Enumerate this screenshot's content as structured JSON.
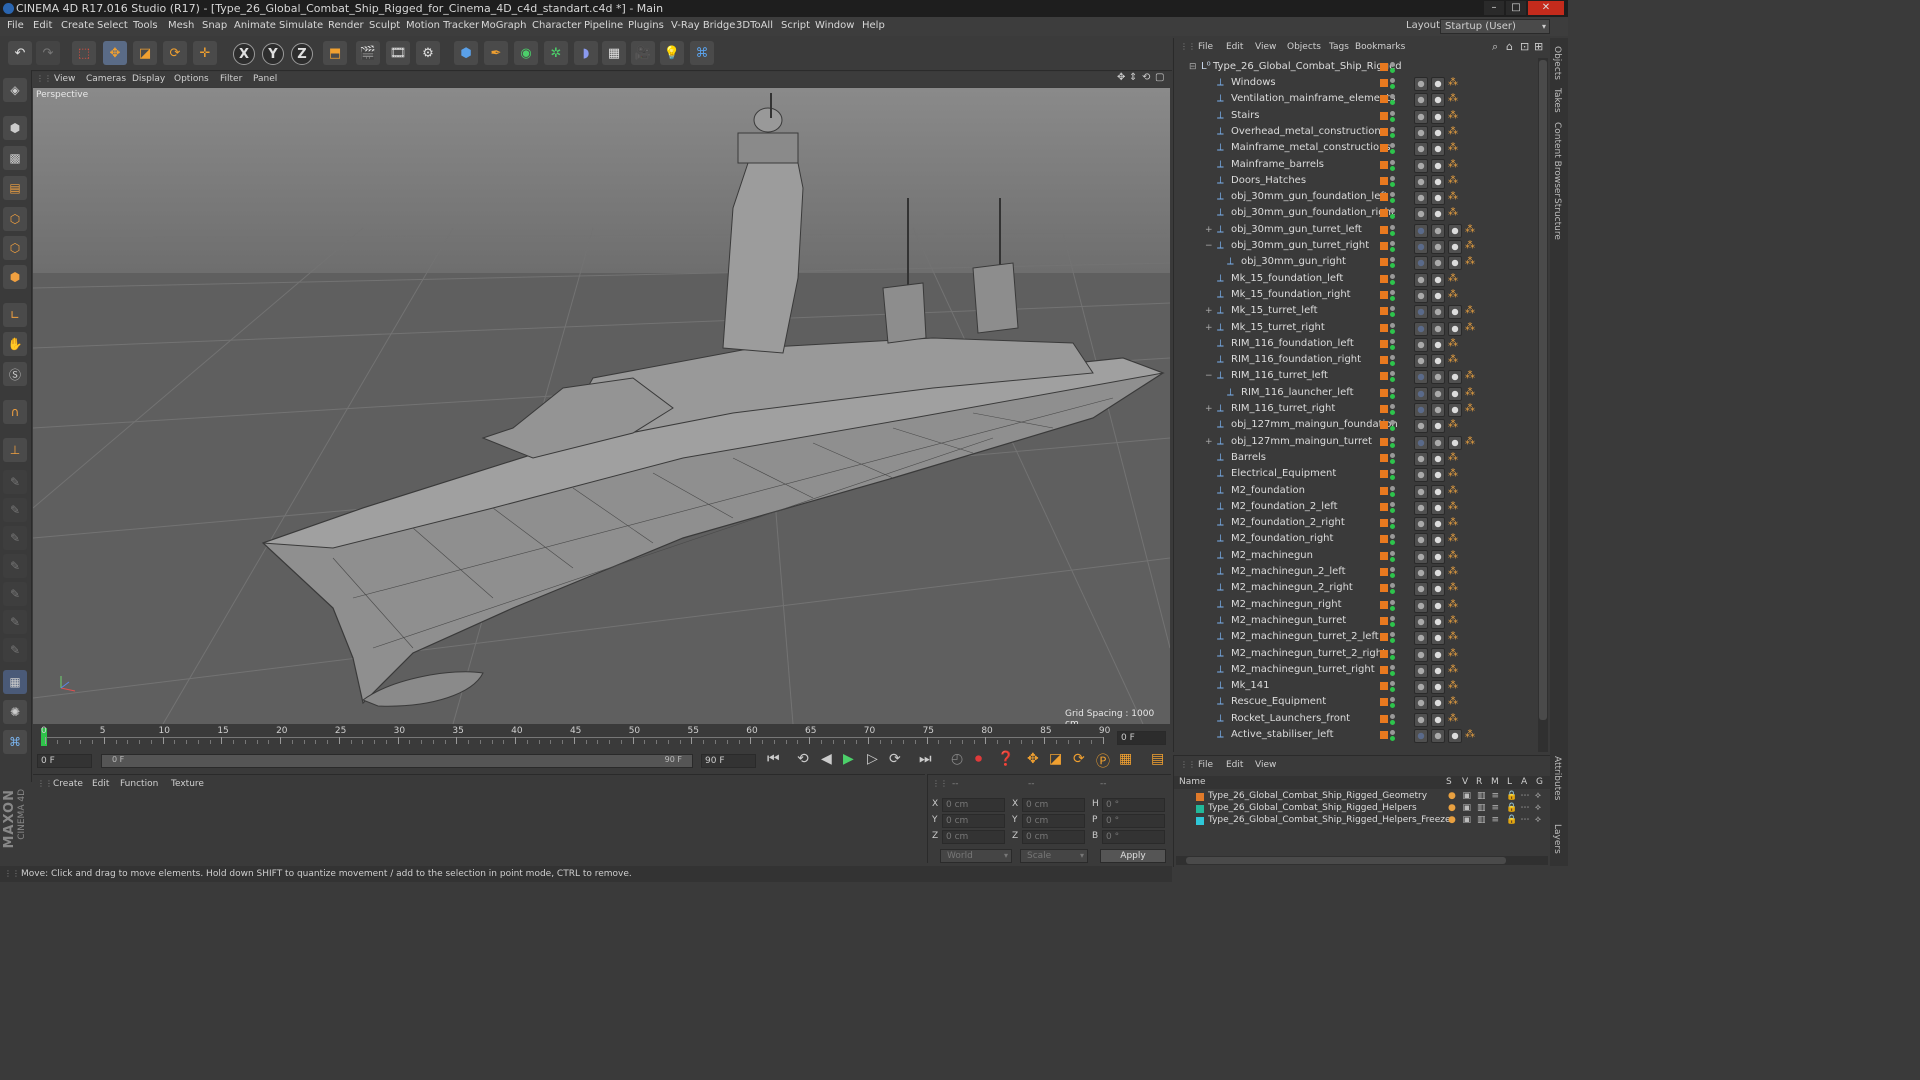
{
  "window": {
    "title": "CINEMA 4D R17.016 Studio (R17) - [Type_26_Global_Combat_Ship_Rigged_for_Cinema_4D_c4d_standart.c4d *] - Main",
    "min": "–",
    "max": "□",
    "close": "✕"
  },
  "menu": [
    "File",
    "Edit",
    "Create",
    "Select",
    "Tools",
    "Mesh",
    "Snap",
    "Animate",
    "Simulate",
    "Render",
    "Sculpt",
    "Motion Tracker",
    "MoGraph",
    "Character",
    "Pipeline",
    "Plugins",
    "V-Ray Bridge",
    "3DToAll",
    "Script",
    "Window",
    "Help"
  ],
  "layout": {
    "label": "Layout:",
    "value": "Startup (User)"
  },
  "toolbar": {
    "x": "X",
    "y": "Y",
    "z": "Z"
  },
  "viewport": {
    "menu": [
      "View",
      "Cameras",
      "Display",
      "Options",
      "Filter",
      "Panel"
    ],
    "name": "Perspective",
    "grid_spacing": "Grid Spacing : 1000 cm"
  },
  "timeline": {
    "ticks": [
      "0",
      "5",
      "10",
      "15",
      "20",
      "25",
      "30",
      "35",
      "40",
      "45",
      "50",
      "55",
      "60",
      "65",
      "70",
      "75",
      "80",
      "85",
      "90"
    ],
    "current_frame": "0 F",
    "start": "0 F",
    "range_start": "0 F",
    "range_end": "90 F",
    "end": "90 F"
  },
  "material_panel": {
    "menu": [
      "Create",
      "Edit",
      "Function",
      "Texture"
    ]
  },
  "attributes": {
    "fields": [
      {
        "l": "X",
        "v": "0 cm"
      },
      {
        "l": "X",
        "v": "0 cm"
      },
      {
        "l": "H",
        "v": "0 °"
      },
      {
        "l": "Y",
        "v": "0 cm"
      },
      {
        "l": "Y",
        "v": "0 cm"
      },
      {
        "l": "P",
        "v": "0 °"
      },
      {
        "l": "Z",
        "v": "0 cm"
      },
      {
        "l": "Z",
        "v": "0 cm"
      },
      {
        "l": "B",
        "v": "0 °"
      }
    ],
    "dash1": "--",
    "dash2": "--",
    "dash3": "--",
    "coord_system": "World",
    "mode": "Scale",
    "apply": "Apply"
  },
  "status": "Move: Click and drag to move elements. Hold down SHIFT to quantize movement / add to the selection in point mode, CTRL to remove.",
  "brand": {
    "maxon": "MAXON",
    "cinema": "CINEMA 4D"
  },
  "objects": {
    "menu": [
      "File",
      "Edit",
      "View",
      "Objects",
      "Tags",
      "Bookmarks"
    ],
    "root": "Type_26_Global_Combat_Ship_Rigged",
    "items": [
      {
        "name": "Windows",
        "level": 1,
        "exp": false,
        "tags": 3
      },
      {
        "name": "Ventilation_mainframe_elements",
        "level": 1,
        "exp": false,
        "tags": 3
      },
      {
        "name": "Stairs",
        "level": 1,
        "exp": false,
        "tags": 3
      },
      {
        "name": "Overhead_metal_constructions",
        "level": 1,
        "exp": false,
        "tags": 3
      },
      {
        "name": "Mainframe_metal_constructions",
        "level": 1,
        "exp": false,
        "tags": 3
      },
      {
        "name": "Mainframe_barrels",
        "level": 1,
        "exp": false,
        "tags": 3
      },
      {
        "name": "Doors_Hatches",
        "level": 1,
        "exp": false,
        "tags": 3
      },
      {
        "name": "obj_30mm_gun_foundation_left",
        "level": 1,
        "exp": false,
        "tags": 3
      },
      {
        "name": "obj_30mm_gun_foundation_right",
        "level": 1,
        "exp": false,
        "tags": 3
      },
      {
        "name": "obj_30mm_gun_turret_left",
        "level": 1,
        "exp": "plus",
        "tags": 4
      },
      {
        "name": "obj_30mm_gun_turret_right",
        "level": 1,
        "exp": "minus",
        "tags": 4
      },
      {
        "name": "obj_30mm_gun_right",
        "level": 2,
        "exp": false,
        "tags": 4
      },
      {
        "name": "Mk_15_foundation_left",
        "level": 1,
        "exp": false,
        "tags": 3
      },
      {
        "name": "Mk_15_foundation_right",
        "level": 1,
        "exp": false,
        "tags": 3
      },
      {
        "name": "Mk_15_turret_left",
        "level": 1,
        "exp": "plus",
        "tags": 4
      },
      {
        "name": "Mk_15_turret_right",
        "level": 1,
        "exp": "plus",
        "tags": 4
      },
      {
        "name": "RIM_116_foundation_left",
        "level": 1,
        "exp": false,
        "tags": 3
      },
      {
        "name": "RIM_116_foundation_right",
        "level": 1,
        "exp": false,
        "tags": 3
      },
      {
        "name": "RIM_116_turret_left",
        "level": 1,
        "exp": "minus",
        "tags": 4
      },
      {
        "name": "RIM_116_launcher_left",
        "level": 2,
        "exp": false,
        "tags": 4
      },
      {
        "name": "RIM_116_turret_right",
        "level": 1,
        "exp": "plus",
        "tags": 4
      },
      {
        "name": "obj_127mm_maingun_foundation",
        "level": 1,
        "exp": false,
        "tags": 3
      },
      {
        "name": "obj_127mm_maingun_turret",
        "level": 1,
        "exp": "plus",
        "tags": 4
      },
      {
        "name": "Barrels",
        "level": 1,
        "exp": false,
        "tags": 3
      },
      {
        "name": "Electrical_Equipment",
        "level": 1,
        "exp": false,
        "tags": 3
      },
      {
        "name": "M2_foundation",
        "level": 1,
        "exp": false,
        "tags": 3
      },
      {
        "name": "M2_foundation_2_left",
        "level": 1,
        "exp": false,
        "tags": 3
      },
      {
        "name": "M2_foundation_2_right",
        "level": 1,
        "exp": false,
        "tags": 3
      },
      {
        "name": "M2_foundation_right",
        "level": 1,
        "exp": false,
        "tags": 3
      },
      {
        "name": "M2_machinegun",
        "level": 1,
        "exp": false,
        "tags": 3
      },
      {
        "name": "M2_machinegun_2_left",
        "level": 1,
        "exp": false,
        "tags": 3
      },
      {
        "name": "M2_machinegun_2_right",
        "level": 1,
        "exp": false,
        "tags": 3
      },
      {
        "name": "M2_machinegun_right",
        "level": 1,
        "exp": false,
        "tags": 3
      },
      {
        "name": "M2_machinegun_turret",
        "level": 1,
        "exp": false,
        "tags": 3
      },
      {
        "name": "M2_machinegun_turret_2_left",
        "level": 1,
        "exp": false,
        "tags": 3
      },
      {
        "name": "M2_machinegun_turret_2_right",
        "level": 1,
        "exp": false,
        "tags": 3
      },
      {
        "name": "M2_machinegun_turret_right",
        "level": 1,
        "exp": false,
        "tags": 3
      },
      {
        "name": "Mk_141",
        "level": 1,
        "exp": false,
        "tags": 3
      },
      {
        "name": "Rescue_Equipment",
        "level": 1,
        "exp": false,
        "tags": 3
      },
      {
        "name": "Rocket_Launchers_front",
        "level": 1,
        "exp": false,
        "tags": 3
      },
      {
        "name": "Active_stabiliser_left",
        "level": 1,
        "exp": false,
        "tags": 4
      }
    ]
  },
  "side_tabs": [
    "Objects",
    "Takes",
    "Content Browser",
    "Structure",
    "Attributes",
    "Layers"
  ],
  "layers": {
    "menu": [
      "File",
      "Edit",
      "View"
    ],
    "columns": [
      "Name",
      "S",
      "V",
      "R",
      "M",
      "L",
      "A",
      "G"
    ],
    "rows": [
      {
        "name": "Type_26_Global_Combat_Ship_Rigged_Geometry",
        "color": "#e07a2a"
      },
      {
        "name": "Type_26_Global_Combat_Ship_Rigged_Helpers",
        "color": "#22b89a"
      },
      {
        "name": "Type_26_Global_Combat_Ship_Rigged_Helpers_Freeze",
        "color": "#2fc7d8"
      }
    ]
  }
}
